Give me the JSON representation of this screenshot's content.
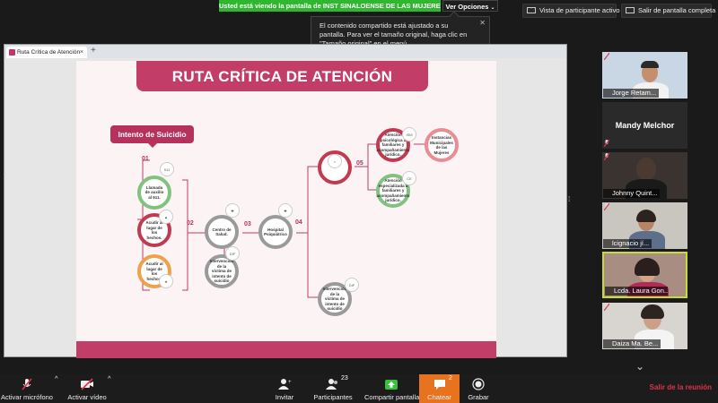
{
  "top": {
    "share_banner": "Usted está viendo la pantalla de INST SINALOENSE DE LAS MUJERES",
    "view_options": "Ver Opciones",
    "gallery_view": "Vista de participante activo",
    "exit_fullscreen": "Salir de pantalla completa",
    "tooltip": "El contenido compartido está ajustado a su pantalla. Para ver el tamaño original, haga clic en \"Tamaño original\" en el menú."
  },
  "browser": {
    "tab_title": "Ruta Crítica de Atención"
  },
  "slide": {
    "title": "RUTA CRÍTICA DE ATENCIÓN",
    "start": "Intento de Suicidio",
    "steps": [
      "01",
      "02",
      "03",
      "04",
      "05"
    ],
    "nodes": {
      "llamada": "Llamada de auxilio al 911.",
      "acudir1": "Acudir al lugar de los hechos.",
      "acudir2": "Acudir al lugar de los hechos.",
      "centro": "Centro de Salud.",
      "hospital": "Hospital Psiquiátrico",
      "interv1": "Intervención de la víctima de intento de suicidio",
      "interv2": "Intervención de la víctima de intento de suicidio",
      "atencion_psico": "Atención psicológica a familiares y acompañamiento jurídico.",
      "instancias": "Instancias Municipales de las Mujeres",
      "atencion_esp": "Atención especializada a familiares y acompañamiento jurídico."
    }
  },
  "participants": [
    {
      "name": "Jorge Retam...",
      "type": "video"
    },
    {
      "name": "Mandy Melchor",
      "type": "name"
    },
    {
      "name": "Johnny Quint...",
      "type": "video"
    },
    {
      "name": "lcignacio jí...",
      "type": "video"
    },
    {
      "name": "Lcda. Laura Gon...",
      "type": "video",
      "active": true
    },
    {
      "name": "Daiza Ma. Be...",
      "type": "video"
    }
  ],
  "toolbar": {
    "mic": "Activar micrófono",
    "video": "Activar vídeo",
    "invite": "Invitar",
    "participants": "Participantes",
    "participants_count": "23",
    "share": "Compartir pantalla",
    "chat": "Chatear",
    "chat_count": "2",
    "record": "Grabar",
    "exit": "Salir de la reunión"
  },
  "colors": {
    "banner_green": "#2fb82f",
    "slide_magenta": "#c23d67",
    "chat_orange": "#e8731f",
    "exit_red": "#e0334b",
    "active_speaker": "#c8dc2f"
  }
}
